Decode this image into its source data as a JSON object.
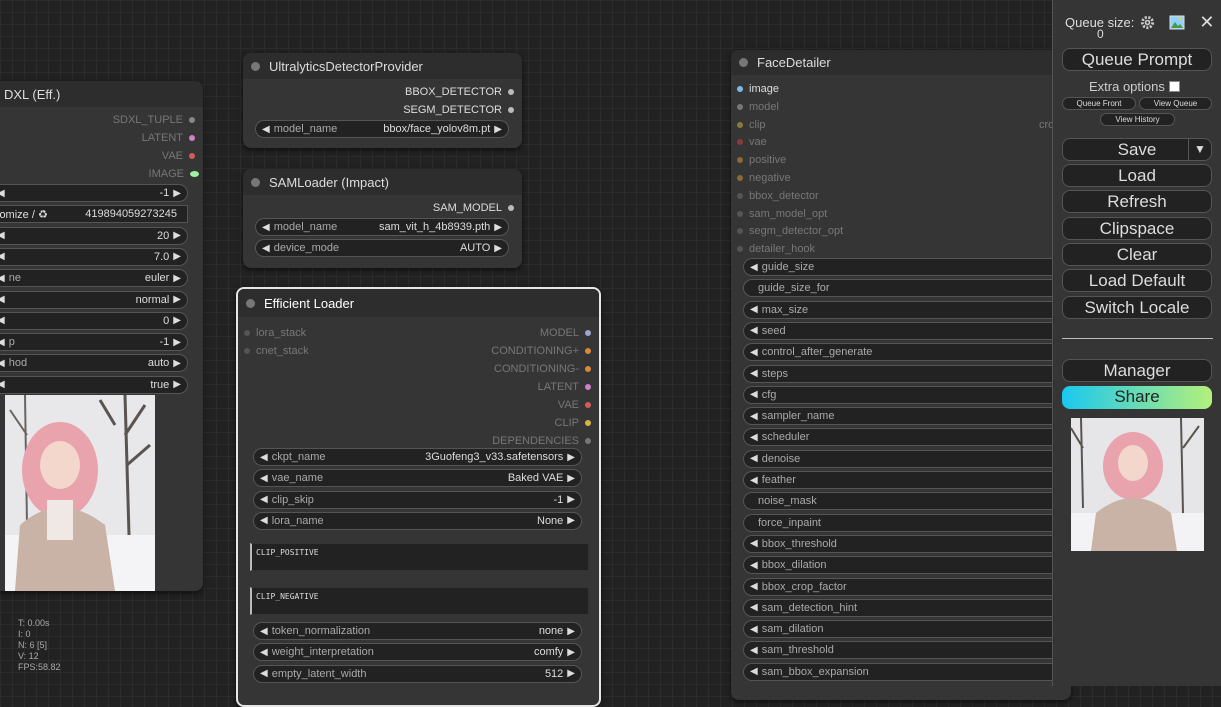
{
  "stats": {
    "t": "T: 0.00s",
    "i": "I: 0",
    "n": "N: 6 [5]",
    "v": "V: 12",
    "fps": "FPS:58.82"
  },
  "sdxl": {
    "title": "DXL (Eff.)",
    "outputs": [
      "SDXL_TUPLE",
      "LATENT",
      "VAE",
      "IMAGE"
    ],
    "widgets": [
      {
        "label": "",
        "value": "-1"
      },
      {
        "label": "lomize / ♻",
        "value": "419894059273245"
      },
      {
        "label": "",
        "value": "20"
      },
      {
        "label": "",
        "value": "7.0"
      },
      {
        "label": "ne",
        "value": "euler"
      },
      {
        "label": "",
        "value": "normal"
      },
      {
        "label": "",
        "value": "0"
      },
      {
        "label": "p",
        "value": "-1"
      },
      {
        "label": "hod",
        "value": "auto"
      },
      {
        "label": "",
        "value": "true"
      }
    ]
  },
  "ultra": {
    "title": "UltralyticsDetectorProvider",
    "outputs": [
      "BBOX_DETECTOR",
      "SEGM_DETECTOR"
    ],
    "model_label": "model_name",
    "model_value": "bbox/face_yolov8m.pt"
  },
  "sam": {
    "title": "SAMLoader (Impact)",
    "outputs": [
      "SAM_MODEL"
    ],
    "widgets": [
      {
        "label": "model_name",
        "value": "sam_vit_h_4b8939.pth"
      },
      {
        "label": "device_mode",
        "value": "AUTO"
      }
    ]
  },
  "eff": {
    "title": "Efficient Loader",
    "inputs": [
      "lora_stack",
      "cnet_stack"
    ],
    "outputs": [
      "MODEL",
      "CONDITIONING+",
      "CONDITIONING-",
      "LATENT",
      "VAE",
      "CLIP",
      "DEPENDENCIES"
    ],
    "widgets_a": [
      {
        "label": "ckpt_name",
        "value": "3Guofeng3_v33.safetensors"
      },
      {
        "label": "vae_name",
        "value": "Baked VAE"
      },
      {
        "label": "clip_skip",
        "value": "-1"
      },
      {
        "label": "lora_name",
        "value": "None"
      }
    ],
    "clip_positive": "CLIP_POSITIVE",
    "clip_negative": "CLIP_NEGATIVE",
    "widgets_b": [
      {
        "label": "token_normalization",
        "value": "none"
      },
      {
        "label": "weight_interpretation",
        "value": "comfy"
      },
      {
        "label": "empty_latent_width",
        "value": "512"
      }
    ]
  },
  "face": {
    "title": "FaceDetailer",
    "inputs": [
      "image",
      "model",
      "clip",
      "vae",
      "positive",
      "negative",
      "bbox_detector",
      "sam_model_opt",
      "segm_detector_opt",
      "detailer_hook"
    ],
    "clip_extra": "cro",
    "widgets": [
      "guide_size",
      "guide_size_for",
      "max_size",
      "seed",
      "control_after_generate",
      "steps",
      "cfg",
      "sampler_name",
      "scheduler",
      "denoise",
      "feather",
      "noise_mask",
      "force_inpaint",
      "bbox_threshold",
      "bbox_dilation",
      "bbox_crop_factor",
      "sam_detection_hint",
      "sam_dilation",
      "sam_threshold",
      "sam_bbox_expansion"
    ],
    "no_arrow": [
      "guide_size_for",
      "noise_mask",
      "force_inpaint"
    ]
  },
  "panel": {
    "queue_size_label": "Queue size:",
    "queue_size": "0",
    "queue_prompt": "Queue Prompt",
    "extra_options": "Extra options",
    "queue_front": "Queue Front",
    "view_queue": "View Queue",
    "view_history": "View History",
    "save": "Save",
    "load": "Load",
    "refresh": "Refresh",
    "clipspace": "Clipspace",
    "clear": "Clear",
    "load_default": "Load Default",
    "switch_locale": "Switch Locale",
    "manager": "Manager",
    "share": "Share"
  },
  "colors": {
    "clip": "#d7b43f",
    "vae": "#d75a5a",
    "image": "#7fd07f",
    "latent": "#d07fc8",
    "conditioning": "#d78a3c",
    "model": "#9aa7d0",
    "share_start": "#1ac8f0",
    "share_end": "#b4f07a"
  }
}
